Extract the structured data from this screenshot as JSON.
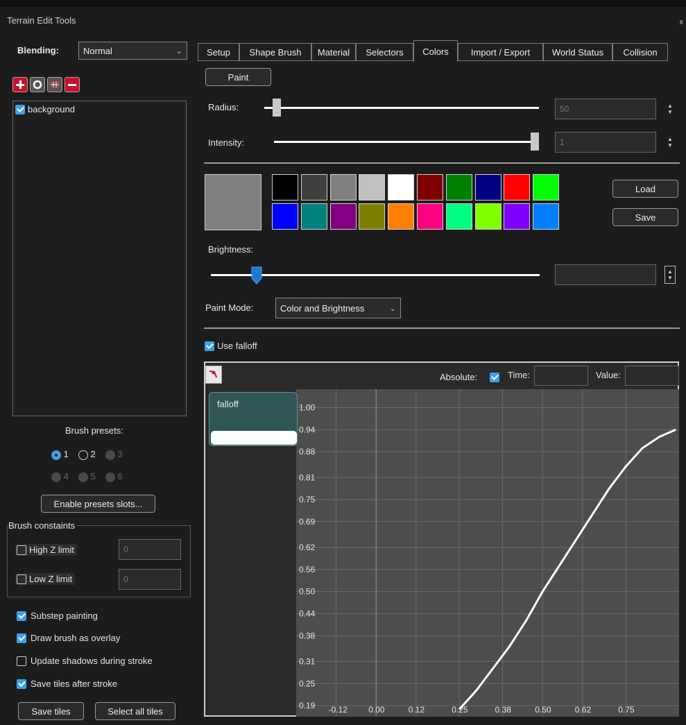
{
  "window": {
    "title": "Terrain Edit Tools",
    "close": "x"
  },
  "left": {
    "blending_label": "Blending:",
    "blending_value": "Normal",
    "layer_tools": [
      "add-layer-icon",
      "circle-layer-icon",
      "grid-layer-icon",
      "remove-layer-icon"
    ],
    "layers": [
      {
        "name": "background",
        "checked": true
      }
    ],
    "brush_presets_label": "Brush presets:",
    "presets": [
      {
        "label": "1",
        "state": "selected"
      },
      {
        "label": "2",
        "state": "enabled"
      },
      {
        "label": "3",
        "state": "disabled"
      },
      {
        "label": "4",
        "state": "disabled"
      },
      {
        "label": "5",
        "state": "disabled"
      },
      {
        "label": "6",
        "state": "disabled"
      }
    ],
    "enable_presets_label": "Enable presets slots...",
    "brush_constraints_label": "Brush constaints",
    "high_z": {
      "label": "High Z limit",
      "value": "0",
      "checked": false
    },
    "low_z": {
      "label": "Low Z limit",
      "value": "0",
      "checked": false
    },
    "options": [
      {
        "label": "Substep painting",
        "checked": true
      },
      {
        "label": "Draw brush as overlay",
        "checked": true
      },
      {
        "label": "Update shadows during stroke",
        "checked": false
      },
      {
        "label": "Save tiles after stroke",
        "checked": true
      }
    ],
    "save_tiles_label": "Save tiles",
    "select_all_tiles_label": "Select all tiles"
  },
  "tabs": [
    "Setup",
    "Shape Brush",
    "Material",
    "Selectors",
    "Colors",
    "Import / Export",
    "World Status",
    "Collision"
  ],
  "active_tab": "Colors",
  "colors": {
    "paint_label": "Paint",
    "radius_label": "Radius:",
    "radius_value": "50",
    "radius_fraction": 0.045,
    "intensity_label": "Intensity:",
    "intensity_value": "1",
    "intensity_fraction": 1.0,
    "current_color": "#7f7f7f",
    "palette_row1": [
      "#000000",
      "#404040",
      "#808080",
      "#c0c0c0",
      "#ffffff",
      "#800000",
      "#008000",
      "#000080",
      "#ff0000",
      "#00ff00"
    ],
    "palette_row2": [
      "#0000ff",
      "#008080",
      "#800080",
      "#808000",
      "#ff8000",
      "#ff0080",
      "#00ff80",
      "#80ff00",
      "#8000ff",
      "#0080ff"
    ],
    "load_label": "Load",
    "save_label": "Save",
    "brightness_label": "Brightness:",
    "brightness_value": "",
    "brightness_fraction": 0.14,
    "paint_mode_label": "Paint Mode:",
    "paint_mode_value": "Color and Brightness",
    "use_falloff_label": "Use falloff",
    "use_falloff_checked": true
  },
  "graph": {
    "absolute_label": "Absolute:",
    "absolute_checked": true,
    "time_label": "Time:",
    "time_value": "",
    "value_label": "Value:",
    "value_value": "",
    "curve_name": "falloff",
    "y_ticks": [
      "1.00",
      "0.94",
      "0.88",
      "0.81",
      "0.75",
      "0.69",
      "0.62",
      "0.56",
      "0.50",
      "0.44",
      "0.38",
      "0.31",
      "0.25",
      "0.19"
    ],
    "x_ticks": [
      "-0.12",
      "0.00",
      "0.12",
      "0.25",
      "0.38",
      "0.50",
      "0.62",
      "0.75"
    ]
  },
  "chart_data": {
    "type": "line",
    "series": [
      {
        "x": [
          0.25,
          0.3,
          0.35,
          0.4,
          0.45,
          0.5,
          0.55,
          0.6,
          0.65,
          0.7,
          0.75,
          0.8,
          0.85,
          0.9
        ],
        "y": [
          0.18,
          0.23,
          0.29,
          0.35,
          0.42,
          0.5,
          0.57,
          0.64,
          0.71,
          0.78,
          0.84,
          0.89,
          0.92,
          0.94
        ]
      }
    ],
    "xlim": [
      -0.24,
      0.91
    ],
    "ylim": [
      0.16,
      1.05
    ],
    "grid": true
  },
  "ui_colors": {
    "accent": "#3ea0e8",
    "curve_item": "#2e5655",
    "plot_bg": "#4d4d4d"
  }
}
